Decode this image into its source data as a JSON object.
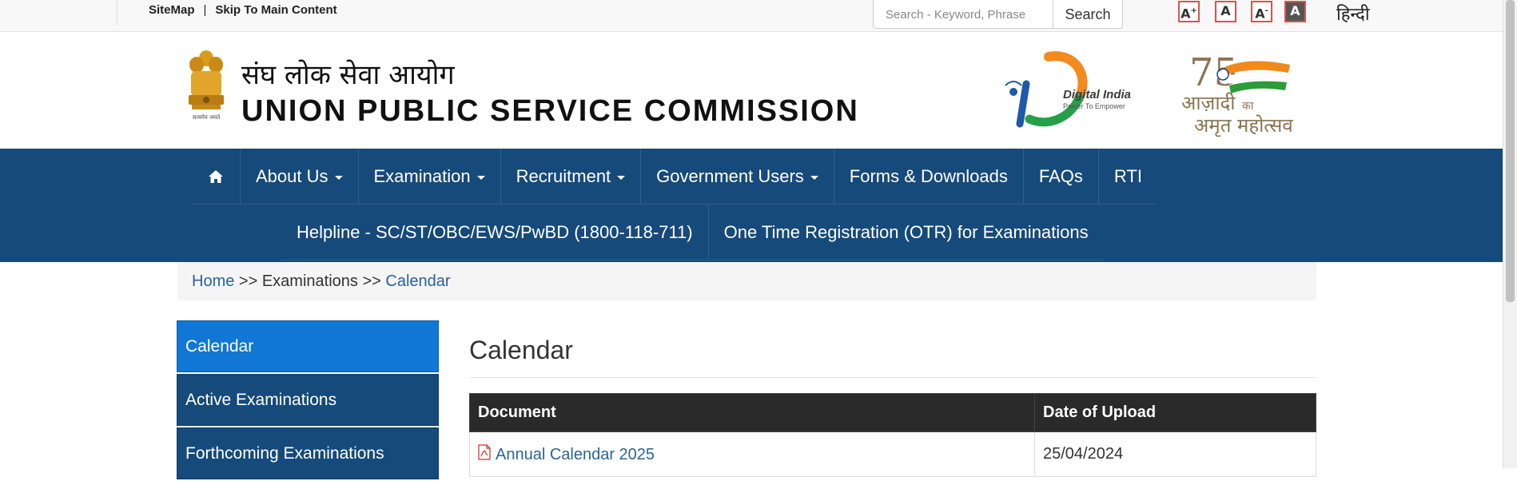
{
  "topbar": {
    "sitemap": "SiteMap",
    "separator": "|",
    "skip": "Skip To Main Content",
    "search_placeholder": "Search - Keyword, Phrase",
    "search_button": "Search",
    "font_sizes": [
      "A",
      "A",
      "A",
      "A"
    ],
    "font_increase_sup": "+",
    "font_decrease_sup": "-",
    "language": "हिन्दी"
  },
  "header": {
    "title_hindi": "संघ लोक सेवा आयोग",
    "title_english": "UNION PUBLIC SERVICE COMMISSION",
    "emblem_motto": "सत्यमेव जयते",
    "digital_india": "Digital India",
    "digital_tagline": "Power To Empower",
    "azadi_number": "75",
    "azadi_line1": "आज़ादी",
    "azadi_ka": "का",
    "azadi_line2": "अमृत महोत्सव"
  },
  "nav": {
    "home_icon": "home-icon",
    "row1": [
      {
        "label": "About Us",
        "dropdown": true
      },
      {
        "label": "Examination",
        "dropdown": true
      },
      {
        "label": "Recruitment",
        "dropdown": true
      },
      {
        "label": "Government Users",
        "dropdown": true
      },
      {
        "label": "Forms & Downloads",
        "dropdown": false
      },
      {
        "label": "FAQs",
        "dropdown": false
      },
      {
        "label": "RTI",
        "dropdown": false
      }
    ],
    "row2": [
      {
        "label": "Helpline - SC/ST/OBC/EWS/PwBD (1800-118-711)"
      },
      {
        "label": "One Time Registration (OTR) for Examinations"
      }
    ]
  },
  "breadcrumb": {
    "home": "Home",
    "sep1": ">>",
    "examinations": "Examinations",
    "sep2": ">>",
    "current": "Calendar"
  },
  "sidebar": {
    "items": [
      {
        "label": "Calendar",
        "active": true
      },
      {
        "label": "Active Examinations",
        "active": false
      },
      {
        "label": "Forthcoming Examinations",
        "active": false
      }
    ]
  },
  "main": {
    "heading": "Calendar",
    "table": {
      "columns": [
        "Document",
        "Date of Upload"
      ],
      "rows": [
        {
          "document": "Annual Calendar 2025",
          "date": "25/04/2024"
        }
      ]
    }
  },
  "colors": {
    "nav_bg": "#164a7b",
    "sidebar_active": "#1177d4",
    "link": "#2a6496",
    "table_header": "#2a2a2a",
    "font_btn_border": "#d9534f"
  }
}
